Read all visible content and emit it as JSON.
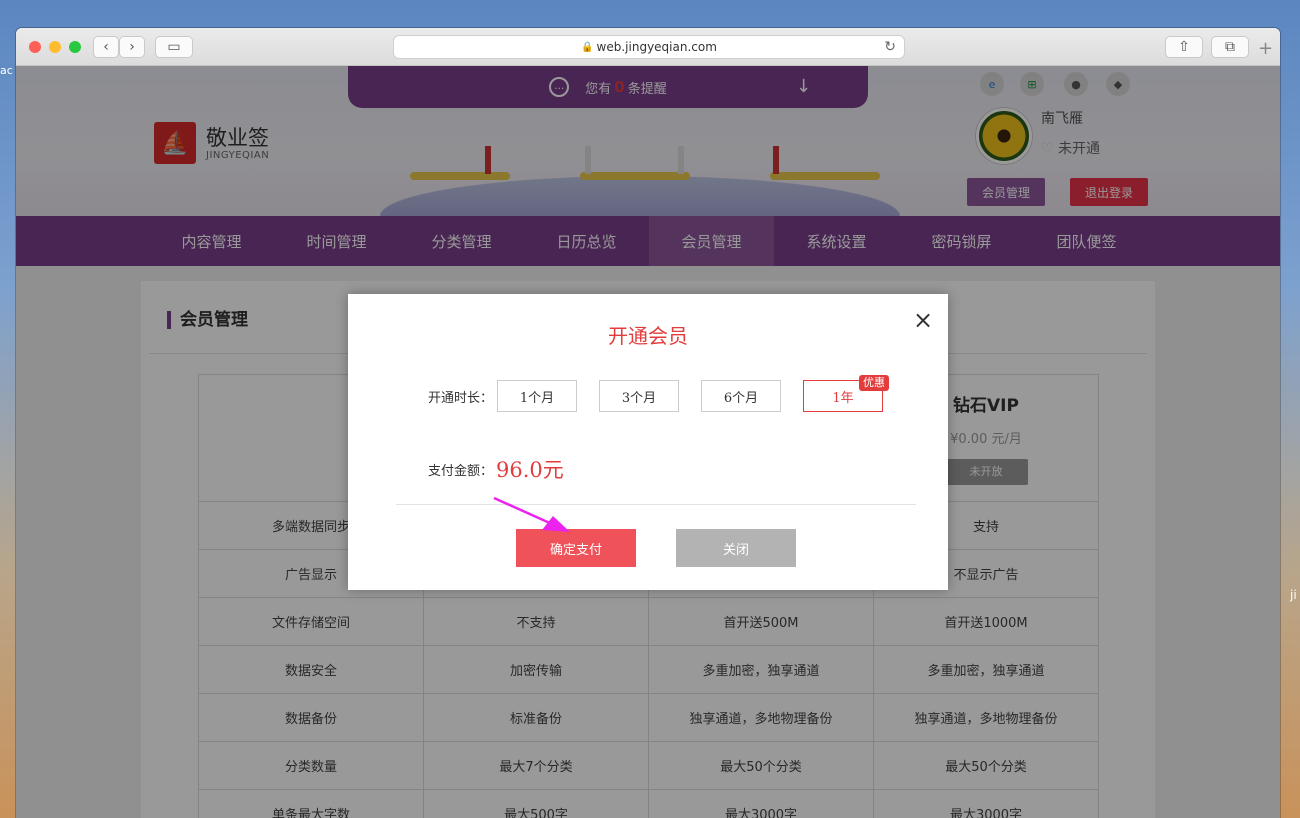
{
  "desktop": {
    "left_text": "ac",
    "right_text": "ji"
  },
  "browser": {
    "url": "web.jingyeqian.com",
    "plus": "+"
  },
  "notice": {
    "prefix": "您有",
    "count": "0",
    "suffix": "条提醒"
  },
  "logo": {
    "cn": "敬业签",
    "en": "JINGYEQIAN"
  },
  "user": {
    "name": "南飞雁",
    "status": "未开通",
    "member_button": "会员管理",
    "logout_button": "退出登录"
  },
  "nav": [
    {
      "label": "内容管理"
    },
    {
      "label": "时间管理"
    },
    {
      "label": "分类管理"
    },
    {
      "label": "日历总览"
    },
    {
      "label": "会员管理",
      "active": true
    },
    {
      "label": "系统设置"
    },
    {
      "label": "密码锁屏"
    },
    {
      "label": "团队便签"
    }
  ],
  "section": {
    "title": "会员管理"
  },
  "vip": {
    "name": "钻石VIP",
    "price": "¥0.00 元/月",
    "button": "未开放"
  },
  "table": {
    "rows": [
      [
        "多端数据同步",
        "",
        "",
        "支持"
      ],
      [
        "广告显示",
        "",
        "",
        "不显示广告"
      ],
      [
        "文件存储空间",
        "不支持",
        "首开送500M",
        "首开送1000M"
      ],
      [
        "数据安全",
        "加密传输",
        "多重加密，独享通道",
        "多重加密，独享通道"
      ],
      [
        "数据备份",
        "标准备份",
        "独享通道，多地物理备份",
        "独享通道，多地物理备份"
      ],
      [
        "分类数量",
        "最大7个分类",
        "最大50个分类",
        "最大50个分类"
      ],
      [
        "单条最大字数",
        "最大500字",
        "最大3000字",
        "最大3000字"
      ]
    ]
  },
  "modal": {
    "title": "开通会员",
    "duration_label": "开通时长：",
    "durations": [
      "1个月",
      "3个月",
      "6个月",
      "1年"
    ],
    "selected_duration": "1年",
    "promo_badge": "优惠",
    "amount_label": "支付金额：",
    "amount": "96.0元",
    "confirm_button": "确定支付",
    "close_button": "关闭"
  },
  "colors": {
    "brand_purple": "#7b3f8c",
    "accent_red": "#e23c3c",
    "member_btn": "#8c559b",
    "logout_btn": "#e8334a",
    "annotation_arrow": "#ee22ee"
  }
}
